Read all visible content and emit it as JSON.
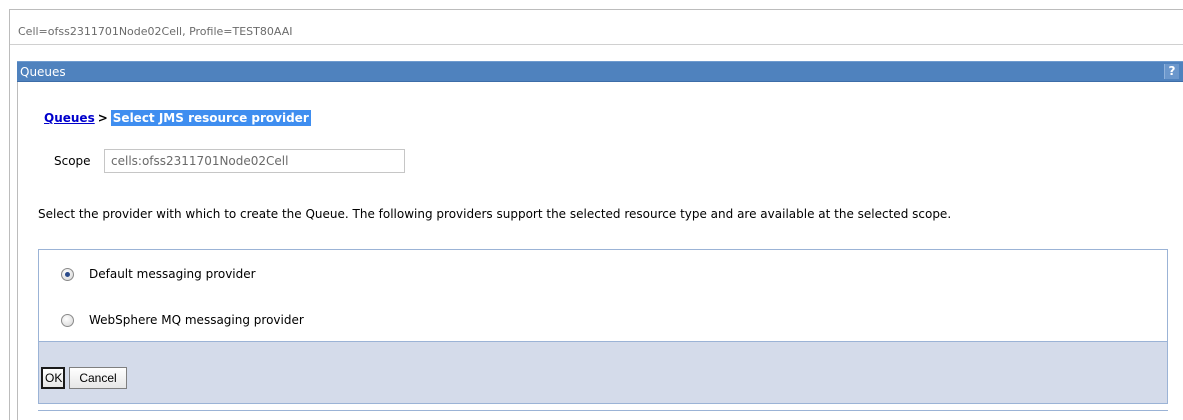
{
  "context": {
    "text": "Cell=ofss2311701Node02Cell, Profile=TEST80AAI"
  },
  "portlet": {
    "title": "Queues",
    "help_label": "?"
  },
  "breadcrumb": {
    "parent": "Queues",
    "separator": ">",
    "current": "Select JMS resource provider"
  },
  "scope": {
    "label": "Scope",
    "value": "cells:ofss2311701Node02Cell"
  },
  "instruction": "Select the provider with which to create the Queue. The following providers support the selected resource type and are available at the selected scope.",
  "providers": [
    {
      "label": "Default messaging provider",
      "selected": true
    },
    {
      "label": "WebSphere MQ messaging provider",
      "selected": false
    }
  ],
  "buttons": {
    "ok": "OK",
    "cancel": "Cancel"
  },
  "colors": {
    "header": "#4f82be",
    "breadcrumb_highlight": "#3f8ef0",
    "button_bar": "#d4dbea"
  }
}
